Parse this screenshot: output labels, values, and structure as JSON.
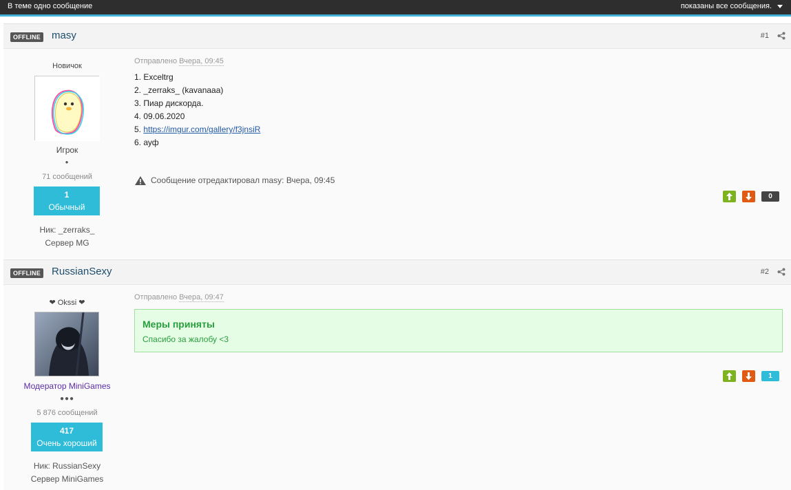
{
  "topbar": {
    "left_text": "В теме одно сообщение",
    "right_text": "показаны все сообщения."
  },
  "posts": [
    {
      "status": "OFFLINE",
      "author": "masy",
      "number": "#1",
      "user_title": "Новичок",
      "role": "Игрок",
      "role_color": "#444444",
      "rank_dots": "●",
      "message_count": "71 сообщений",
      "reputation": {
        "value": "1",
        "label": "Обычный"
      },
      "nick_line": "Ник: _zerraks_",
      "server_line": "Сервер MG",
      "posted_prefix": "Отправлено",
      "posted_when": "Вчера, 09:45",
      "lines": [
        "1. Exceltrg",
        "2. _zerraks_ (kavanaaa)",
        "3. Пиар дискорда.",
        "4. 09.06.2020",
        "5. ",
        "6. ауф"
      ],
      "link_text": "https://imgur.com/gallery/f3jnsiR",
      "edited_note": "Сообщение отредактировал masy: Вчера, 09:45",
      "score": "0",
      "score_color": "#444444"
    },
    {
      "status": "OFFLINE",
      "author": "RussianSexy",
      "number": "#2",
      "user_title": "❤ Okssi ❤",
      "role": "Модератор MiniGames",
      "role_color": "#5a2ca8",
      "rank_dots": "●●●",
      "message_count": "5 876 сообщений",
      "reputation": {
        "value": "417",
        "label": "Очень хороший"
      },
      "nick_line": "Ник: RussianSexy",
      "server_line": "Сервер MiniGames",
      "posted_prefix": "Отправлено",
      "posted_when": "Вчера, 09:47",
      "notice_title": "Меры приняты",
      "notice_text": "Спасибо за жалобу <3",
      "score": "1",
      "score_color": "#2ebcd9"
    }
  ],
  "icons": {
    "share": "share-icon",
    "warning": "warning-icon",
    "vote_up": "arrow-up-icon",
    "vote_down": "arrow-down-icon",
    "caret": "chevron-down-icon"
  }
}
